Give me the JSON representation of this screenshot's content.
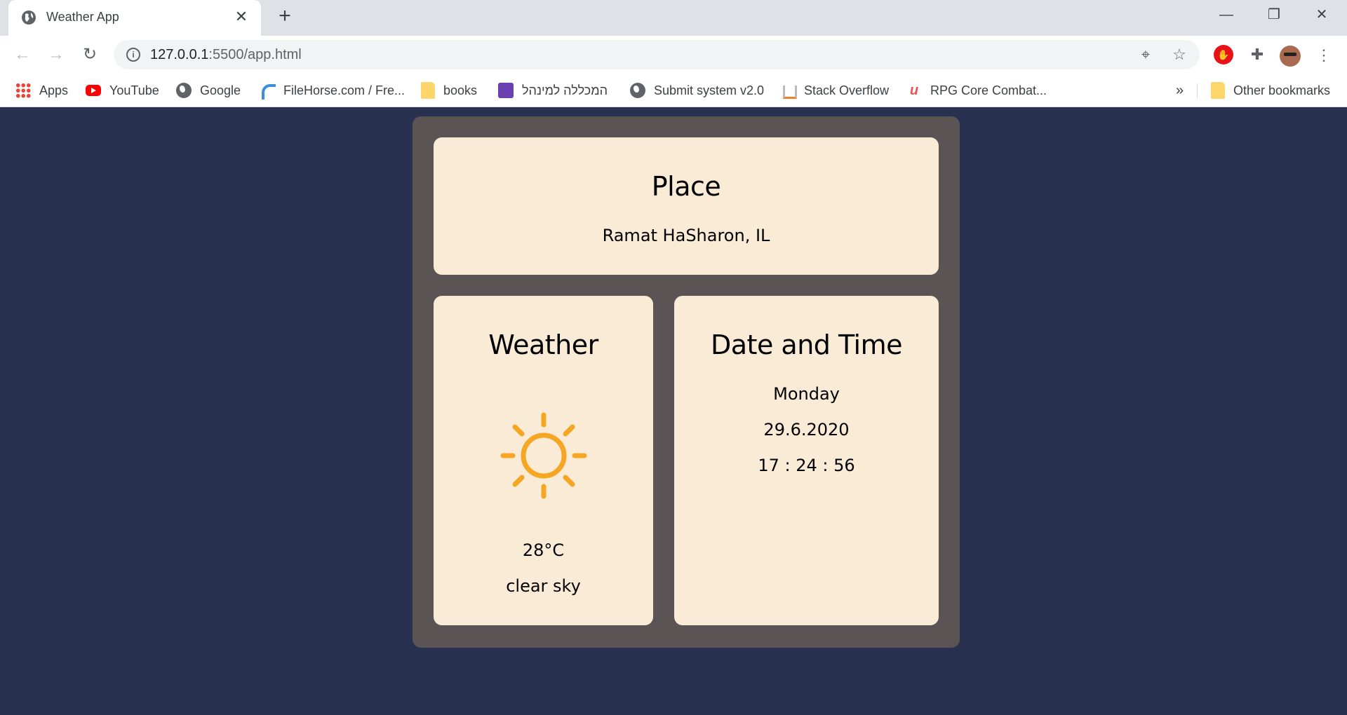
{
  "browser": {
    "tab": {
      "title": "Weather App",
      "favicon": "globe-icon"
    },
    "window_controls": {
      "minimize": "—",
      "restore": "❐",
      "close": "✕"
    },
    "url": {
      "host": "127.0.0.1",
      "path": ":5500/app.html"
    },
    "bookmarks": [
      {
        "label": "Apps",
        "icon": "apps-grid-icon"
      },
      {
        "label": "YouTube",
        "icon": "youtube-icon"
      },
      {
        "label": "Google",
        "icon": "globe-icon"
      },
      {
        "label": "FileHorse.com / Fre...",
        "icon": "filehorse-icon"
      },
      {
        "label": "books",
        "icon": "folder-icon"
      },
      {
        "label": "המכללה למינהל",
        "icon": "college-icon"
      },
      {
        "label": "Submit system v2.0",
        "icon": "globe-icon"
      },
      {
        "label": "Stack Overflow",
        "icon": "stackoverflow-icon"
      },
      {
        "label": "RPG Core Combat...",
        "icon": "udemy-icon"
      }
    ],
    "bookmarks_overflow": "»",
    "other_bookmarks": "Other bookmarks"
  },
  "app": {
    "place": {
      "title": "Place",
      "value": "Ramat HaSharon, IL"
    },
    "weather": {
      "title": "Weather",
      "icon": "sun-icon",
      "temperature": "28°C",
      "description": "clear sky"
    },
    "datetime": {
      "title": "Date and Time",
      "day": "Monday",
      "date": "29.6.2020",
      "time": "17 : 24 : 56"
    }
  },
  "colors": {
    "page_background": "#283250",
    "container": "#5a5554",
    "card": "#faebd7",
    "sun": "#f5a623"
  }
}
